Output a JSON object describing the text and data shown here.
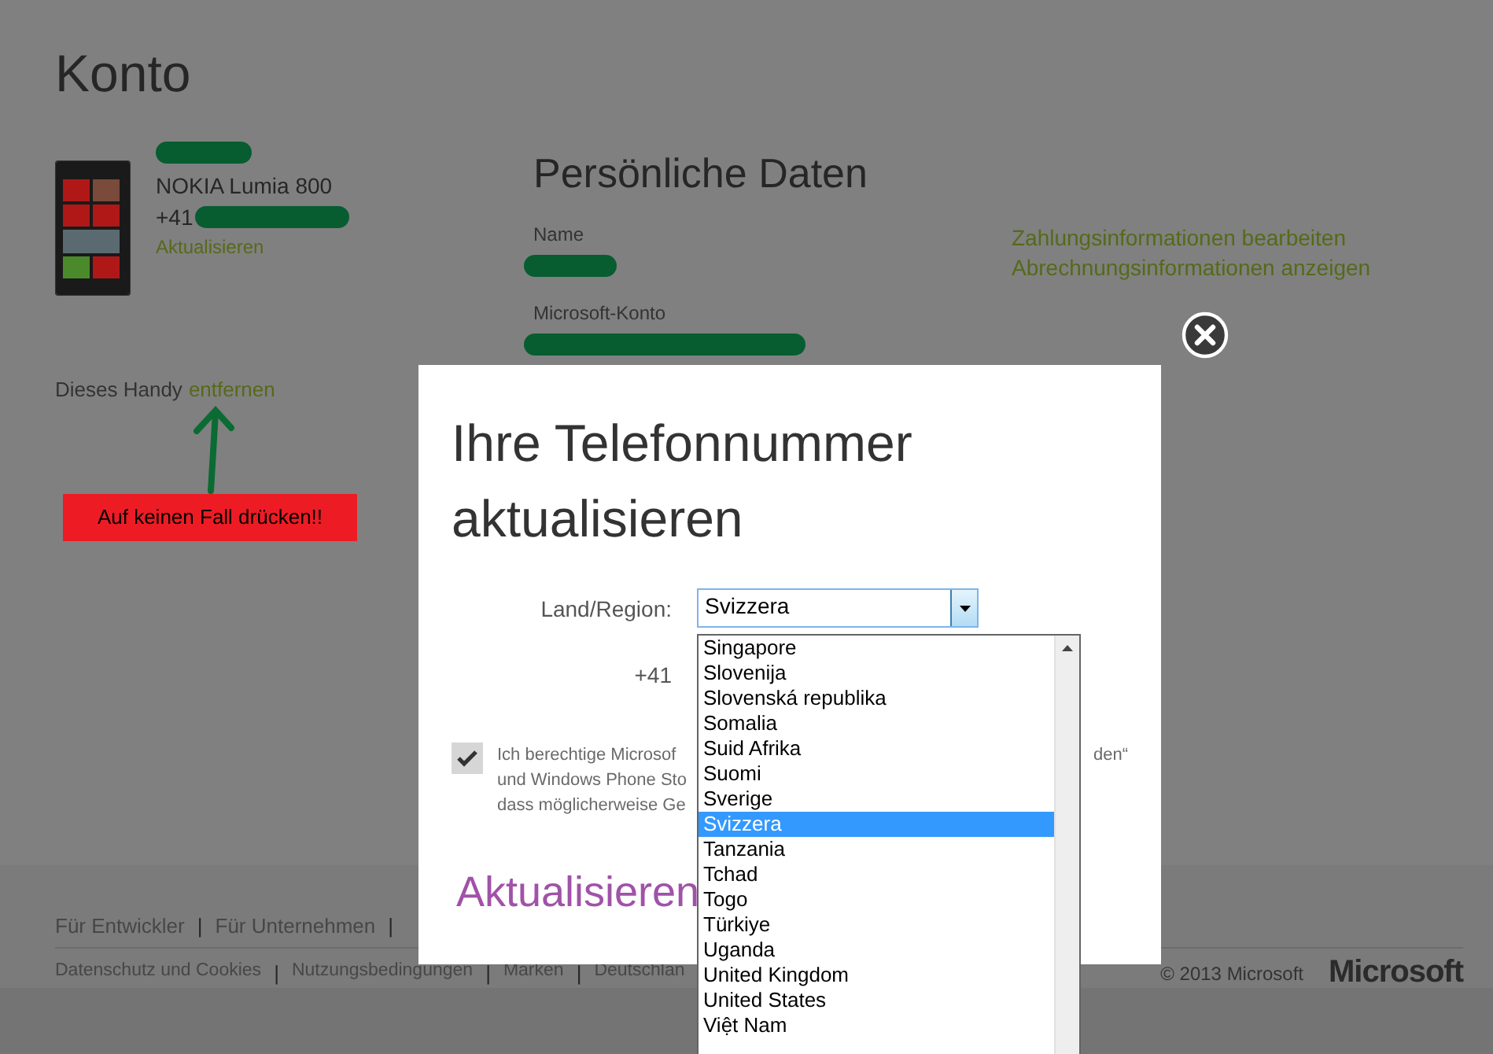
{
  "page": {
    "title": "Konto"
  },
  "device": {
    "model": "NOKIA Lumia 800",
    "phone_prefix": "+41",
    "update_link": "Aktualisieren",
    "remove_text": "Dieses Handy",
    "remove_link": "entfernen"
  },
  "annotation": {
    "text": "Auf keinen Fall drücken!!"
  },
  "personal": {
    "title": "Persönliche Daten",
    "fields": [
      {
        "label": "Name"
      },
      {
        "label": "Microsoft-Konto"
      }
    ],
    "links": [
      "Zahlungsinformationen bearbeiten",
      "Abrechnungsinformationen anzeigen"
    ]
  },
  "dialog": {
    "title": "Ihre Telefonnummer aktualisieren",
    "country_label": "Land/Region:",
    "country_value": "Svizzera",
    "dial_code": "+41",
    "country_options": [
      {
        "label": "Singapore",
        "selected": false
      },
      {
        "label": "Slovenija",
        "selected": false
      },
      {
        "label": "Slovenská republika",
        "selected": false
      },
      {
        "label": "Somalia",
        "selected": false
      },
      {
        "label": "Suid Afrika",
        "selected": false
      },
      {
        "label": "Suomi",
        "selected": false
      },
      {
        "label": "Sverige",
        "selected": false
      },
      {
        "label": "Svizzera",
        "selected": true
      },
      {
        "label": "Tanzania",
        "selected": false
      },
      {
        "label": "Tchad",
        "selected": false
      },
      {
        "label": "Togo",
        "selected": false
      },
      {
        "label": "Türkiye",
        "selected": false
      },
      {
        "label": "Uganda",
        "selected": false
      },
      {
        "label": "United Kingdom",
        "selected": false
      },
      {
        "label": "United States",
        "selected": false
      },
      {
        "label": "Việt Nam",
        "selected": false
      }
    ],
    "consent": {
      "checked": true,
      "lines": [
        {
          "left": "Ich berechtige Microsof",
          "right": "den“"
        },
        {
          "left": "und Windows Phone Sto"
        },
        {
          "left": "dass möglicherweise Ge"
        }
      ]
    },
    "submit": "Aktualisieren"
  },
  "footer": {
    "row1": [
      {
        "kind": "link",
        "text": "Für Entwickler"
      },
      {
        "kind": "separator",
        "text": "|"
      },
      {
        "kind": "link",
        "text": "Für Unternehmen"
      },
      {
        "kind": "separator",
        "text": "|"
      }
    ],
    "row2": [
      {
        "kind": "link",
        "text": "Datenschutz und Cookies"
      },
      {
        "kind": "separator",
        "text": "|"
      },
      {
        "kind": "link",
        "text": "Nutzungsbedingungen"
      },
      {
        "kind": "separator",
        "text": "|"
      },
      {
        "kind": "link",
        "text": "Marken"
      },
      {
        "kind": "separator",
        "text": "|"
      },
      {
        "kind": "link",
        "text": "Deutschlan"
      }
    ],
    "copyright": "© 2013 Microsoft",
    "logo": "Microsoft"
  }
}
